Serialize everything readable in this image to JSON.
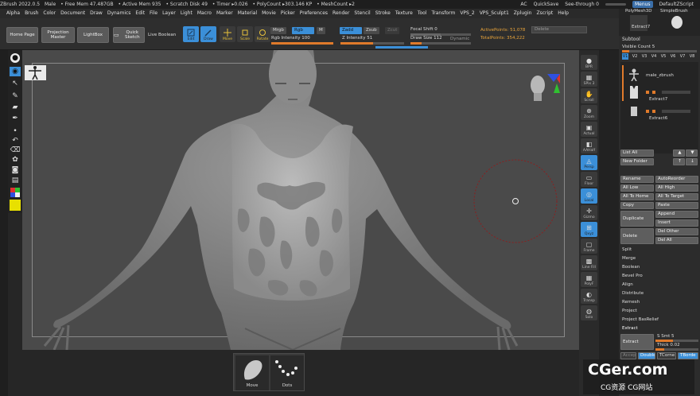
{
  "titlebar": {
    "items": [
      "ZBrush 2022.0.5",
      "Male",
      "• Free Mem 47.487GB",
      "• Active Mem 935",
      "• Scratch Disk 49",
      "• Timer ▸0.026",
      "• PolyCount ▸303.146 KP",
      "• MeshCount ▸2"
    ],
    "ac": "AC",
    "quicksave": "QuickSave",
    "see_through": "See-through 0",
    "menus": "Menus",
    "script": "DefaultZScript"
  },
  "menu": [
    "Alpha",
    "Brush",
    "Color",
    "Document",
    "Draw",
    "Dynamics",
    "Edit",
    "File",
    "Layer",
    "Light",
    "Macro",
    "Marker",
    "Material",
    "Movie",
    "Picker",
    "Preferences",
    "Render",
    "Stencil",
    "Stroke",
    "Texture",
    "Tool",
    "Transform",
    "VPS_2",
    "VPS_Sculpt1",
    "Zplugin",
    "Zscript",
    "Help"
  ],
  "shelf": {
    "home_page": "Home Page",
    "projection_master": "Projection Master",
    "lightbox": "LightBox",
    "quick_sketch": "Quick Sketch",
    "live_boolean": "Live Boolean",
    "edit": "Edit",
    "draw": "Draw",
    "move": "Move",
    "scale": "Scale",
    "rotate": "Rotate",
    "mrgb": "Mrgb",
    "rgb": "Rgb",
    "m": "M",
    "rgb_intensity": "Rgb Intensity 100",
    "zadd": "Zadd",
    "zsub": "Zsub",
    "zcut": "Zcut",
    "z_intensity": "Z Intensity 51",
    "z_intensity_value": 0.51,
    "focal_shift": "Focal Shift 0",
    "draw_size": "Draw Size 112",
    "dynamic": "Dynamic",
    "active_points": "ActivePoints: 51,078",
    "total_points": "TotalPoints: 354,222",
    "delete": "Delete"
  },
  "right_shelf": [
    {
      "label": "BPR",
      "icon": "sphere"
    },
    {
      "label": "SPix 3",
      "icon": "spix"
    },
    {
      "label": "Scroll",
      "icon": "hand"
    },
    {
      "label": "Zoom",
      "icon": "zoom"
    },
    {
      "label": "Actual",
      "icon": "actual"
    },
    {
      "label": "AAHalf",
      "icon": "aahalf"
    },
    {
      "label": "Persp",
      "icon": "persp"
    },
    {
      "label": "Floor",
      "icon": "floor"
    },
    {
      "label": "Local",
      "icon": "local"
    },
    {
      "label": "Gizmo",
      "icon": "gizmo"
    },
    {
      "label": "Qxyz",
      "icon": "xyz"
    },
    {
      "label": "Frame",
      "icon": "frame"
    },
    {
      "label": "Line Fill",
      "icon": "linefill"
    },
    {
      "label": "PolyF",
      "icon": "polyf"
    },
    {
      "label": "Transp",
      "icon": "transp"
    },
    {
      "label": "Solo",
      "icon": "solo"
    }
  ],
  "right_panel": {
    "polymesh": "PolyMesh3D",
    "simplebrush": "SimpleBrush",
    "extract7_top": "Extract7",
    "subtool_title": "Subtool",
    "visible_count": "Visible Count 5",
    "v_tabs": [
      "V1",
      "V2",
      "V3",
      "V4",
      "V5",
      "V6",
      "V7",
      "V8"
    ],
    "subtools": [
      "male_zbrush",
      "Extract7",
      "Extract6"
    ],
    "list_all": "List All",
    "new_folder": "New Folder",
    "rename": "Rename",
    "autoreorder": "AutoReorder",
    "all_low": "All Low",
    "all_high": "All High",
    "all_to_home": "All To Home",
    "all_to_target": "All To Target",
    "copy": "Copy",
    "paste": "Paste",
    "duplicate": "Duplicate",
    "append": "Append",
    "insert": "Insert",
    "delete": "Delete",
    "del_other": "Del Other",
    "del_all": "Del All",
    "split": "Split",
    "merge": "Merge",
    "boolean": "Boolean",
    "bevel_pro": "Bevel Pro",
    "align": "Align",
    "distribute": "Distribute",
    "remesh": "Remesh",
    "project": "Project",
    "project_basrelief": "Project BasRelief",
    "extract_section": "Extract",
    "extract_btn": "Extract",
    "s_smt": "S Smt 5",
    "thick": "Thick 0.02",
    "accept": "Accept",
    "double": "Double",
    "tcorne": "TCorne",
    "tborder": "TBorde"
  },
  "bottom_tray": {
    "move": "Move",
    "dots": "Dots"
  },
  "watermark": {
    "main": "CGer.com",
    "sub": "CG资源 CG网站"
  },
  "colors": {
    "accent": "#3b8fd8",
    "orange": "#e07a2b",
    "viewport": "#4a4a4a",
    "yellow": "#e8e000"
  }
}
